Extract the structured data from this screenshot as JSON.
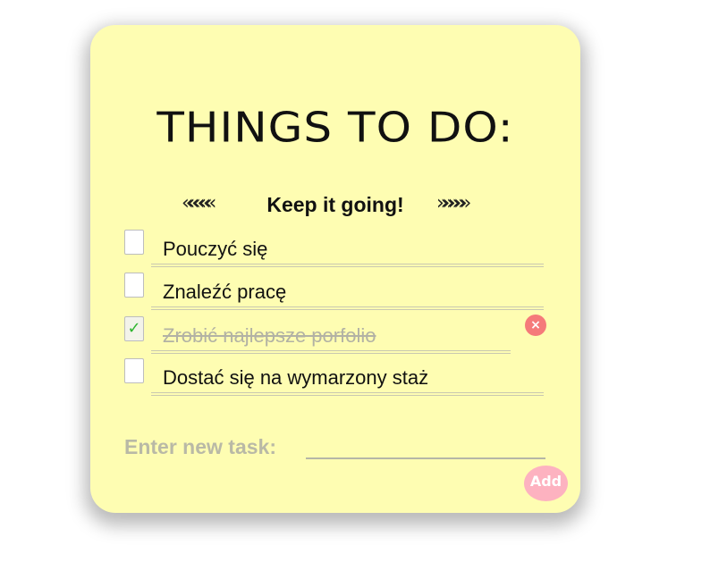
{
  "note": {
    "title": "THINGS TO DO:",
    "subtitle": "Keep it going!",
    "chevrons_left": "«««««",
    "chevrons_right": "»»»»»"
  },
  "tasks": [
    {
      "text": "Pouczyć się",
      "done": false
    },
    {
      "text": "Znaleźć pracę",
      "done": false
    },
    {
      "text": "Zrobić najlepsze porfolio",
      "done": true
    },
    {
      "text": "Dostać się na wymarzony staż",
      "done": false
    }
  ],
  "checkmark": "✓",
  "delete_symbol": "×",
  "new_task": {
    "label": "Enter new task:",
    "value": "",
    "add_label": "Add"
  },
  "colors": {
    "note_bg": "#fefdb2",
    "add_button": "#fdb2c0",
    "delete_button": "#f57a7a",
    "check": "#2fb52f"
  }
}
